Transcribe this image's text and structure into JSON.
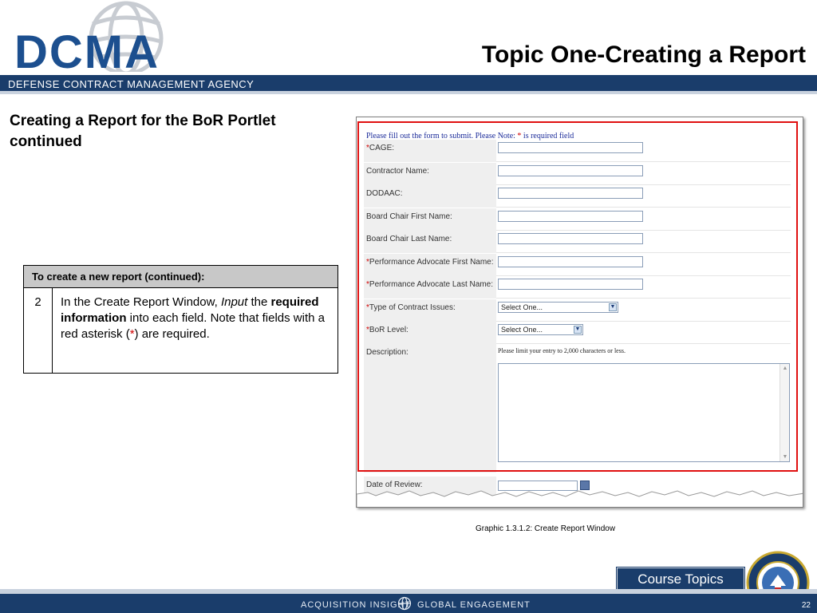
{
  "header": {
    "logo_text": "DCMA",
    "agency_name": "DEFENSE CONTRACT MANAGEMENT AGENCY",
    "slide_title": "Topic One-Creating a Report",
    "brand_color": "#1a3d6b"
  },
  "main": {
    "subheading": "Creating a Report for the BoR Portlet continued",
    "table": {
      "header": "To create a new report (continued):",
      "rows": [
        {
          "step": "2",
          "text_1": "In the Create Report Window, ",
          "text_italic": "Input",
          "text_2": " the ",
          "text_bold": "required information",
          "text_3": " into each field.  Note that fields with a red asterisk (",
          "text_star": "*",
          "text_4": ") are required."
        }
      ]
    }
  },
  "screenshot": {
    "notice": "Please fill out the form to submit. Please Note: ",
    "notice_star": "*",
    "notice_end": " is required field",
    "fields": [
      {
        "label": "CAGE:",
        "required": true,
        "type": "text"
      },
      {
        "label": "Contractor Name:",
        "required": false,
        "type": "text"
      },
      {
        "label": "DODAAC:",
        "required": false,
        "type": "text"
      },
      {
        "label": "Board Chair First Name:",
        "required": false,
        "type": "text"
      },
      {
        "label": "Board Chair Last Name:",
        "required": false,
        "type": "text"
      },
      {
        "label": "Performance Advocate First Name:",
        "required": true,
        "type": "text"
      },
      {
        "label": "Performance Advocate Last Name:",
        "required": true,
        "type": "text"
      },
      {
        "label": "Type of Contract Issues:",
        "required": true,
        "type": "select",
        "selected": "Select One..."
      },
      {
        "label": "BoR Level:",
        "required": true,
        "type": "select",
        "selected": "Select One..."
      }
    ],
    "description_label": "Description:",
    "description_note": "Please limit your entry to 2,000 characters or less.",
    "date_label": "Date of Review:",
    "highlight_color": "#e01010"
  },
  "caption": "Graphic  1.3.1.2:  Create Report Window",
  "nav": {
    "course_topics": "Course Topics"
  },
  "footer": {
    "left_text": "ACQUISITION INSIGHT",
    "right_text": "GLOBAL ENGAGEMENT",
    "page_number": "22"
  }
}
